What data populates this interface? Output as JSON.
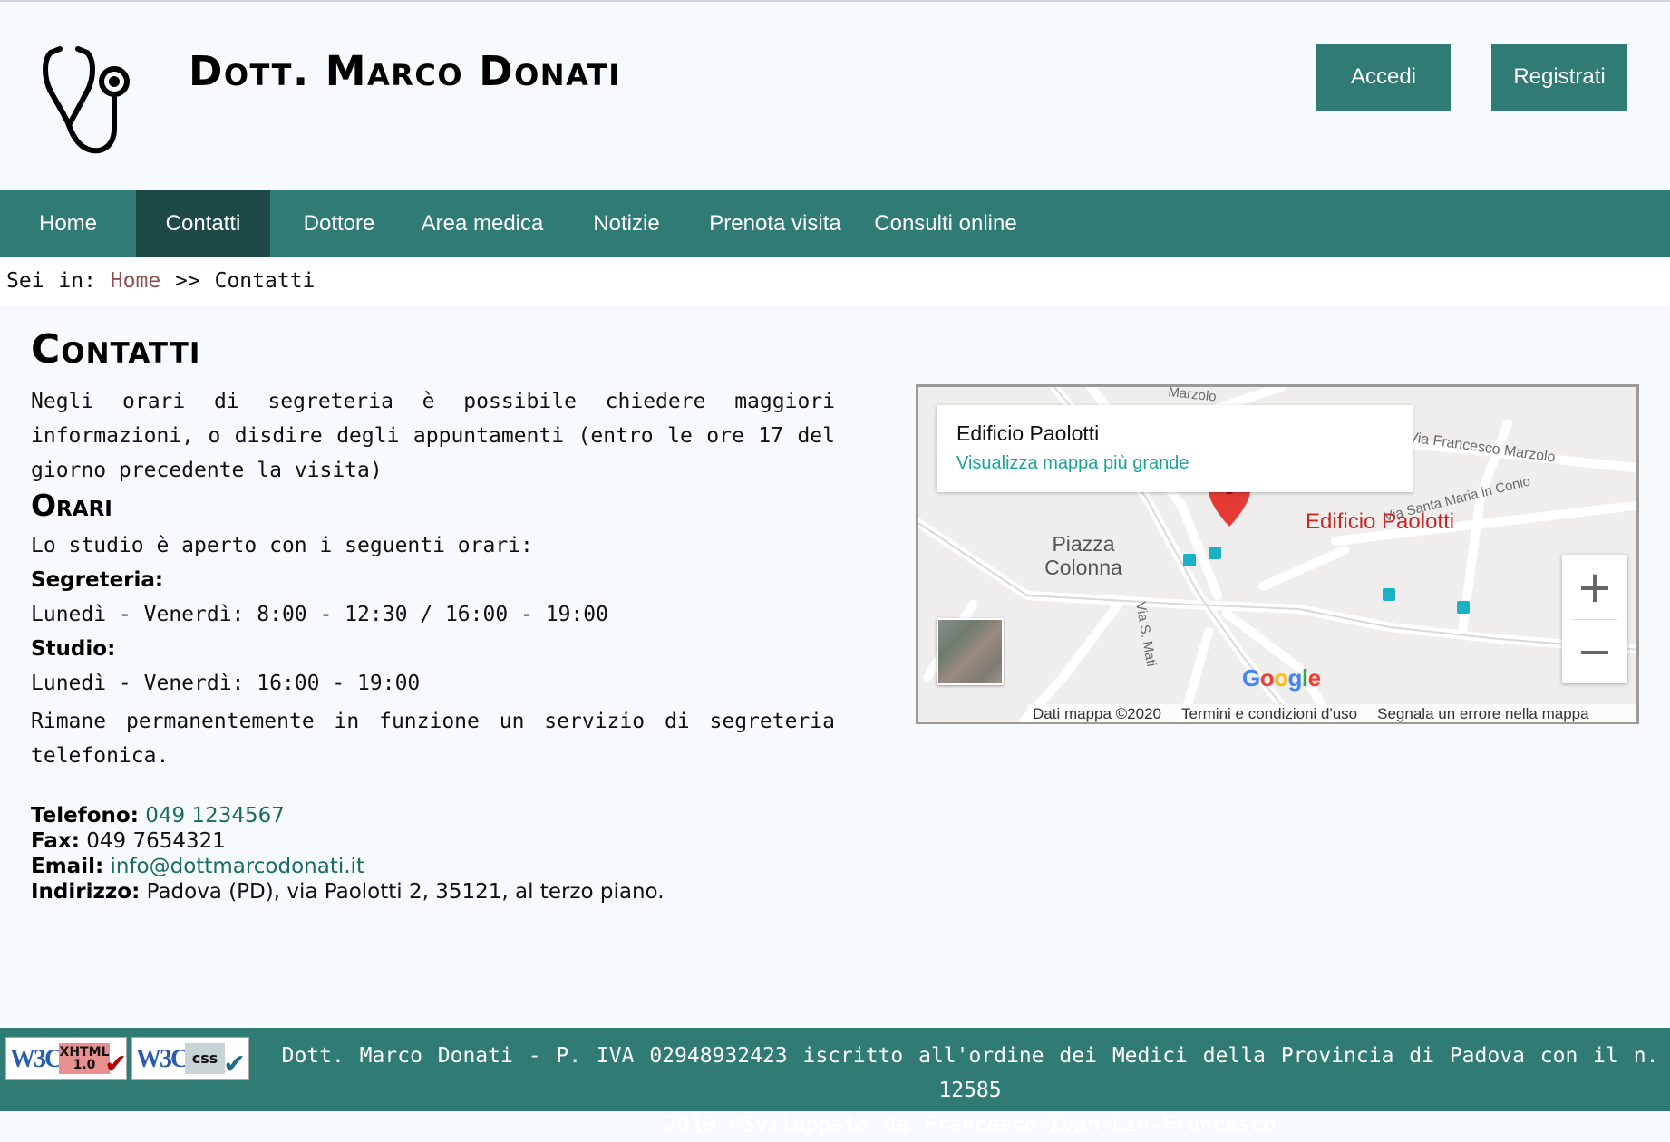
{
  "header": {
    "site_title": "Dott. Marco Donati",
    "logo_icon": "stethoscope-icon",
    "login_label": "Accedi",
    "register_label": "Registrati"
  },
  "nav": {
    "items": [
      {
        "label": "Home",
        "active": false
      },
      {
        "label": "Contatti",
        "active": true
      },
      {
        "label": "Dottore",
        "active": false
      },
      {
        "label": "Area medica",
        "active": false
      },
      {
        "label": "Notizie",
        "active": false
      },
      {
        "label": "Prenota visita",
        "active": false
      },
      {
        "label": "Consulti online",
        "active": false
      }
    ]
  },
  "breadcrumb": {
    "prefix": "Sei in:",
    "home": "Home",
    "separator": ">>",
    "current": "Contatti"
  },
  "main": {
    "title": "Contatti",
    "intro": "Negli orari di segreteria è possibile chiedere maggiori informazioni, o disdire degli appuntamenti (entro le ore 17 del giorno precedente la visita)",
    "section_title": "Orari",
    "open_text": "Lo studio è aperto con i seguenti orari:",
    "secretary_label": "Segreteria:",
    "secretary_hours": "Lunedì - Venerdì: 8:00 - 12:30 / 16:00 - 19:00",
    "studio_label": "Studio:",
    "studio_hours": "Lunedì - Venerdì: 16:00 - 19:00",
    "answering_note": "Rimane permanentemente in funzione un servizio di segreteria telefonica.",
    "contacts": {
      "phone_label": "Telefono:",
      "phone": "049 1234567",
      "fax_label": "Fax:",
      "fax": "049 7654321",
      "email_label": "Email:",
      "email": "info@dottmarcodonati.it",
      "address_label": "Indirizzo:",
      "address": "Padova (PD), via Paolotti 2, 35121, al terzo piano."
    }
  },
  "map": {
    "card_title": "Edificio Paolotti",
    "card_link": "Visualizza mappa più grande",
    "pin_label": "Edificio Paolotti",
    "place_label": "Piazza Colonna",
    "street_1": "Via Francesco Marzolo",
    "street_2": "Via Santa Maria in Conio",
    "street_3": "Via S. Mati",
    "street_4": "Marzolo",
    "zoom_in": "+",
    "zoom_out": "−",
    "brand": "Google",
    "data_credit": "Dati mappa ©2020",
    "terms": "Termini e condizioni d'uso",
    "report": "Segnala un errore nella mappa"
  },
  "footer": {
    "line1": "Dott. Marco Donati - P. IVA 02948932423 iscritto all'ordine dei Medici della Provincia di Padova con il n. 12585",
    "line2": "2019 ©Sviluppato da Francesco-Ivan-Lin-Francesco",
    "badge_xhtml_w3c": "W3C",
    "badge_xhtml_tag": "XHTML 1.0",
    "badge_css_w3c": "W3C",
    "badge_css_tag": "css"
  },
  "colors": {
    "primary": "#307b74",
    "primary_dark": "#1d4a46",
    "link": "#1a6b62",
    "breadcrumb_link": "#8b4f4f"
  }
}
